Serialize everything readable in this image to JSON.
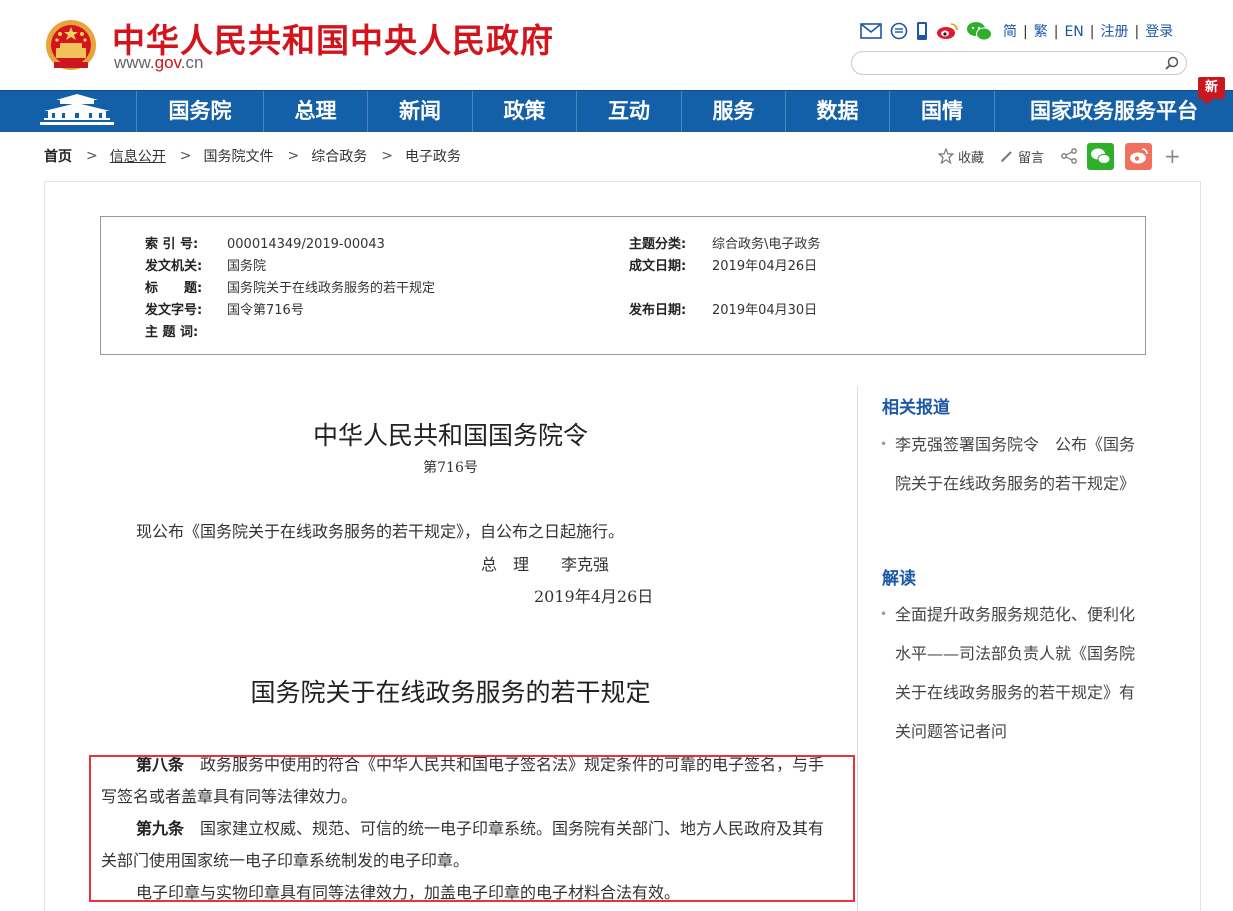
{
  "header": {
    "site_title": "中华人民共和国中央人民政府",
    "domain_prefix": "www.",
    "domain_brand": "gov",
    "domain_suffix": ".cn",
    "links": [
      "简",
      "繁",
      "EN",
      "注册",
      "登录"
    ]
  },
  "nav": {
    "items": [
      "国务院",
      "总理",
      "新闻",
      "政策",
      "互动",
      "服务",
      "数据",
      "国情",
      "国家政务服务平台"
    ],
    "new_badge": "新"
  },
  "breadcrumb": [
    "首页",
    "信息公开",
    "国务院文件",
    "综合政务",
    "电子政务"
  ],
  "share": {
    "favorite": "收藏",
    "comment": "留言",
    "more": "+"
  },
  "meta": {
    "index_label": "索 引 号:",
    "index_value": "000014349/2019-00043",
    "topic_label": "主题分类:",
    "topic_value": "综合政务\\电子政务",
    "issuer_label": "发文机关:",
    "issuer_value": "国务院",
    "written_label": "成文日期:",
    "written_value": "2019年04月26日",
    "title_label": "标　　题:",
    "title_value": "国务院关于在线政务服务的若干规定",
    "docno_label": "发文字号:",
    "docno_value": "国令第716号",
    "published_label": "发布日期:",
    "published_value": "2019年04月30日",
    "keywords_label": "主 题 词:"
  },
  "document": {
    "order_title": "中华人民共和国国务院令",
    "order_no": "第716号",
    "announcement": "现公布《国务院关于在线政务服务的若干规定》，自公布之日起施行。",
    "signature": "总　理　　李克强",
    "date": "2019年4月26日",
    "doc_title": "国务院关于在线政务服务的若干规定",
    "art8_label": "第八条",
    "art8_text": "政务服务中使用的符合《中华人民共和国电子签名法》规定条件的可靠的电子签名，与手写签名或者盖章具有同等法律效力。",
    "art9_label": "第九条",
    "art9_text": "国家建立权威、规范、可信的统一电子印章系统。国务院有关部门、地方人民政府及其有关部门使用国家统一电子印章系统制发的电子印章。",
    "art9_cont": "电子印章与实物印章具有同等法律效力，加盖电子印章的电子材料合法有效。"
  },
  "sidebar": {
    "related_heading": "相关报道",
    "related_item": "李克强签署国务院令　公布《国务院关于在线政务服务的若干规定》",
    "interpret_heading": "解读",
    "interpret_item": "全面提升政务服务规范化、便利化水平——司法部负责人就《国务院关于在线政务服务的若干规定》有关问题答记者问"
  },
  "colors": {
    "brand_red": "#d2141d",
    "nav_blue": "#1460a8",
    "link_blue": "#1d58a7",
    "highlight_red": "#e8333a"
  }
}
